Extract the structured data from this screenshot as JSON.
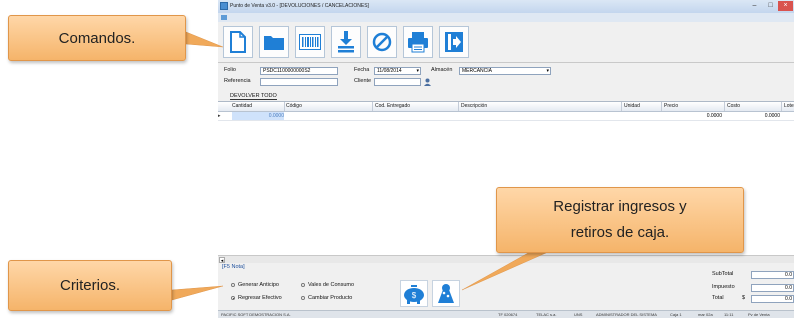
{
  "window": {
    "title": "Punto de Venta v3.0 - [DEVOLUCIONES / CANCELACIONES]",
    "controls": [
      "–",
      "□",
      "×"
    ]
  },
  "toolbar": {
    "buttons": [
      {
        "icon": "new-document-icon"
      },
      {
        "icon": "folder-icon"
      },
      {
        "icon": "barcode-icon"
      },
      {
        "icon": "download-icon"
      },
      {
        "icon": "cancel-icon"
      },
      {
        "icon": "printer-icon"
      },
      {
        "icon": "exit-icon"
      }
    ]
  },
  "form": {
    "folio_label": "Folio",
    "folio_value": "PSDC1100000000S2",
    "fecha_label": "Fecha",
    "fecha_value": "11/08/2014",
    "almacen_label": "Almacén",
    "almacen_value": "MERCANCIA",
    "referencia_label": "Referencia",
    "cliente_label": "Cliente",
    "cliente_value": ""
  },
  "devolver_todo": "DEVOLVER TODO",
  "grid": {
    "columns": [
      "Cantidad",
      "Código",
      "Cod. Entregado",
      "Descripción",
      "Unidad",
      "Precio",
      "Costo",
      "Lote"
    ],
    "row": {
      "cantidad": "0.0000",
      "precio": "0.0000",
      "costo": "0.0000"
    }
  },
  "bottom": {
    "f5_label": "[F5 Nota]",
    "options": [
      {
        "label": "Generar Anticipo",
        "selected": false
      },
      {
        "label": "Vales de Consumo",
        "selected": false
      },
      {
        "label": "Regresar Efectivo",
        "selected": true
      },
      {
        "label": "Cambiar Producto",
        "selected": false
      }
    ],
    "subtotal_label": "SubTotal",
    "subtotal_value": "0.0",
    "impuesto_label": "Impuesto",
    "impuesto_value": "0.0",
    "total_label": "Total",
    "currency": "$",
    "total_value": "0.0"
  },
  "status": {
    "items": [
      "PACIFIC SOFT DEMOSTRACION S.A.",
      "TF 020674",
      "TELAC s.a.",
      "UNS",
      "ADMINISTRADOR DEL SISTEMA",
      "Caja 1",
      "mar 02a",
      "11:11",
      "Pv de Venta"
    ]
  },
  "callouts": {
    "comandos": "Comandos.",
    "registrar_line1": "Registrar ingresos y",
    "registrar_line2": "retiros de caja.",
    "criterios": "Criterios."
  },
  "colors": {
    "accent": "#1f7fd6",
    "callout": "#f5b46a",
    "window_bg": "#f0f0f0"
  }
}
